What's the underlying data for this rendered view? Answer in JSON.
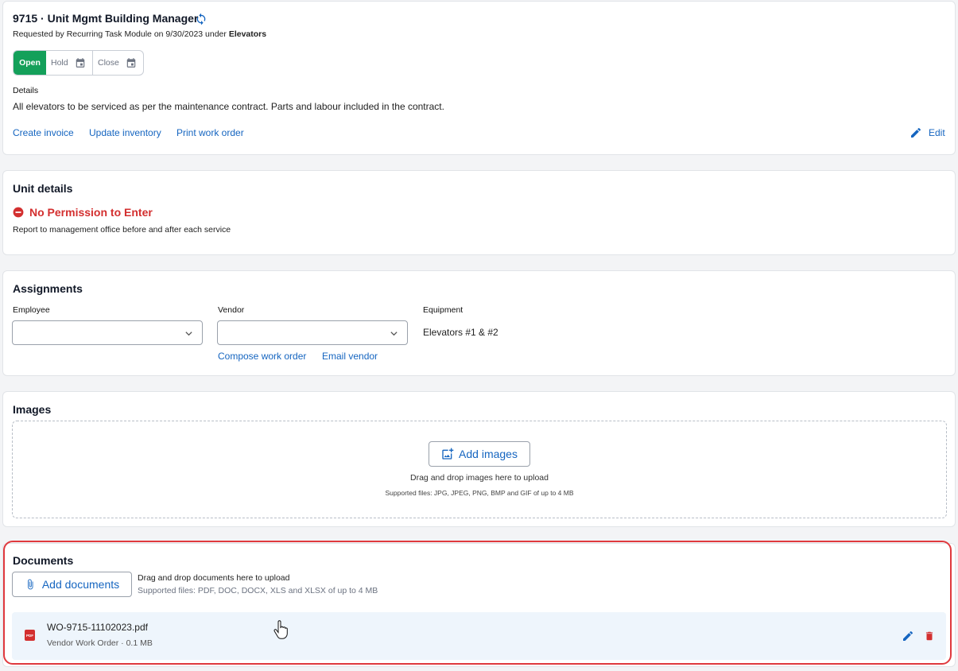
{
  "header": {
    "title": "9715 · Unit Mgmt Building Manager",
    "subtitle_prefix": "Requested by Recurring Task Module on 9/30/2023 under ",
    "subtitle_category": "Elevators",
    "status": {
      "open": "Open",
      "hold": "Hold",
      "close": "Close",
      "selected": "Open"
    },
    "details_label": "Details",
    "details_text": "All elevators to be serviced as per the maintenance contract. Parts and labour included in the contract.",
    "links": {
      "create_invoice": "Create invoice",
      "update_inventory": "Update inventory",
      "print_work_order": "Print work order"
    },
    "edit_label": "Edit"
  },
  "unit": {
    "title": "Unit details",
    "permission": "No Permission to Enter",
    "note": "Report to management office before and after each service"
  },
  "assignments": {
    "title": "Assignments",
    "employee_label": "Employee",
    "employee_value": "",
    "vendor_label": "Vendor",
    "vendor_value": "",
    "equipment_label": "Equipment",
    "equipment_value": "Elevators #1 & #2",
    "compose_link": "Compose work order",
    "email_link": "Email vendor"
  },
  "images": {
    "title": "Images",
    "add_label": "Add images",
    "drop_text": "Drag and drop images here to upload",
    "supported": "Supported files: JPG, JPEG, PNG, BMP and GIF of up to 4 MB"
  },
  "documents": {
    "title": "Documents",
    "add_label": "Add documents",
    "drop_text": "Drag and drop documents here to upload",
    "supported": "Supported files: PDF, DOC, DOCX, XLS and XLSX of up to 4 MB",
    "files": [
      {
        "name": "WO-9715-11102023.pdf",
        "meta": "Vendor Work Order · 0.1 MB",
        "type_badge": "PDF"
      }
    ]
  },
  "colors": {
    "accent": "#1565c0",
    "status_open": "#14a05a",
    "danger": "#d32f2f",
    "highlight": "#e0393e"
  },
  "icons": [
    "refresh-icon",
    "calendar-icon",
    "edit-pencil-icon",
    "minus-circle-icon",
    "chevron-down-icon",
    "add-photo-icon",
    "paperclip-icon",
    "pdf-file-icon",
    "trash-icon",
    "hand-cursor-icon"
  ]
}
